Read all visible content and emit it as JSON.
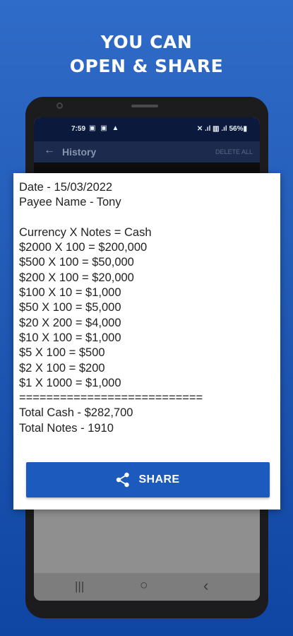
{
  "headline": {
    "line1": "YOU CAN",
    "line2": "OPEN & SHARE"
  },
  "status_bar": {
    "time": "7:59",
    "left_icons": "▣ ▣ ▲",
    "right_icons": "✕ .ıl ▥ .ıl 56%▮"
  },
  "app_bar": {
    "back_icon": "←",
    "title": "History",
    "action": "DELETE ALL"
  },
  "receipt": {
    "lines": [
      "Date - 15/03/2022",
      "Payee Name - Tony",
      "",
      "Currency X Notes = Cash",
      "$2000 X 100 = $200,000",
      "$500 X 100 = $50,000",
      "$200 X 100 = $20,000",
      "$100 X 10 = $1,000",
      "$50 X 100 = $5,000",
      "$20 X 200 = $4,000",
      "$10 X 100 = $1,000",
      "$5 X 100 = $500",
      "$2 X 100 = $200",
      "$1 X 1000 = $1,000",
      "===========================",
      "Total Cash - $282,700",
      "Total Notes - 1910"
    ]
  },
  "share_button": {
    "label": "SHARE",
    "icon": "share-icon"
  },
  "nav_bar": {
    "recents": "|||",
    "home": "○",
    "back": "‹"
  },
  "colors": {
    "accent": "#1c5bbd",
    "background": "#215bb6"
  }
}
